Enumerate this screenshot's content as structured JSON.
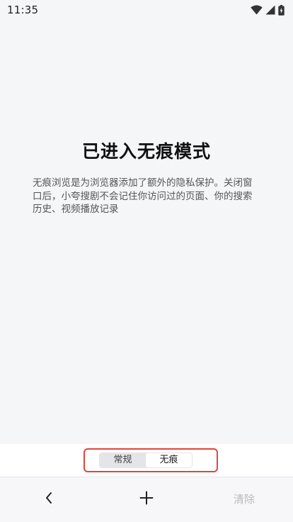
{
  "status_bar": {
    "time": "11:35",
    "icons": [
      "wifi-icon",
      "signal-icon",
      "battery-icon"
    ]
  },
  "main": {
    "title": "已进入无痕模式",
    "description": "无痕浏览是为浏览器添加了额外的隐私保护。关闭窗口后，小夸搜剧不会记住你访问过的页面、你的搜索历史、视频播放记录"
  },
  "mode_switch": {
    "options": [
      {
        "label": "常规",
        "active": false
      },
      {
        "label": "无痕",
        "active": true
      }
    ],
    "highlight_color": "#e0453a"
  },
  "bottom_nav": {
    "back_icon": "chevron-left-icon",
    "add_icon": "plus-icon",
    "clear_label": "清除"
  }
}
